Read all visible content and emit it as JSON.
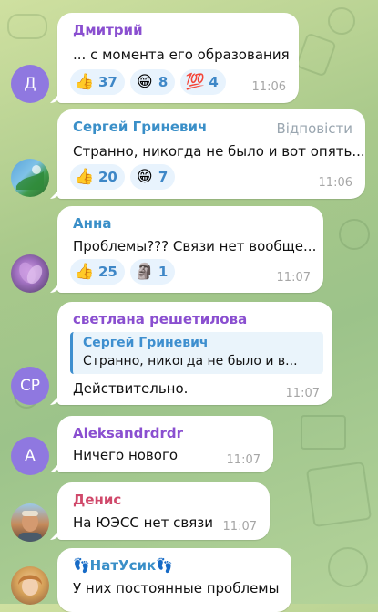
{
  "messages": [
    {
      "sender": "Дмитрий",
      "sender_color": "#8a4fd0",
      "avatar_initials": "Д",
      "avatar_color": "#8f78e0",
      "text": "... с момента его образования",
      "time": "11:06",
      "reactions": [
        {
          "icon": "thumbs-up-icon",
          "glyph": "👍",
          "count": "37"
        },
        {
          "icon": "grinning-face-icon",
          "glyph": "😁",
          "count": "8"
        },
        {
          "icon": "hundred-points-icon",
          "glyph": "💯",
          "count": "4"
        }
      ]
    },
    {
      "sender": "Сергей Гриневич",
      "sender_color": "#3a8fc8",
      "avatar_color": "#5aa3d8",
      "reply_label": "Відповісти",
      "text": "Странно, никогда не было и вот опять...",
      "time": "11:06",
      "reactions": [
        {
          "icon": "thumbs-up-icon",
          "glyph": "👍",
          "count": "20"
        },
        {
          "icon": "grinning-face-icon",
          "glyph": "😁",
          "count": "7"
        }
      ]
    },
    {
      "sender": "Анна",
      "sender_color": "#3a8fc8",
      "avatar_color": "#9a6fa8",
      "text": "Проблемы??? Связи нет вообще...",
      "time": "11:07",
      "reactions": [
        {
          "icon": "thumbs-up-icon",
          "glyph": "👍",
          "count": "25"
        },
        {
          "icon": "moai-icon",
          "glyph": "🗿",
          "count": "1"
        }
      ]
    },
    {
      "sender": "светлана решетилова",
      "sender_color": "#8a4fd0",
      "avatar_initials": "СР",
      "avatar_color": "#8f78e0",
      "quote": {
        "name": "Сергей Гриневич",
        "text": "Странно, никогда не было и в..."
      },
      "text": "Действительно.",
      "time": "11:07"
    },
    {
      "sender": "Aleksandrdrdr",
      "sender_color": "#8a4fd0",
      "avatar_initials": "А",
      "avatar_color": "#8f78e0",
      "text": "Ничего нового",
      "time": "11:07"
    },
    {
      "sender": "Денис",
      "sender_color": "#d0486a",
      "avatar_color": "#c58a5a",
      "text": "На ЮЭСС нет связи",
      "time": "11:07"
    },
    {
      "sender": "👣НатУсик👣",
      "sender_color": "#3a8fc8",
      "avatar_color": "#d6a25a",
      "text": "У них постоянные проблемы"
    }
  ]
}
